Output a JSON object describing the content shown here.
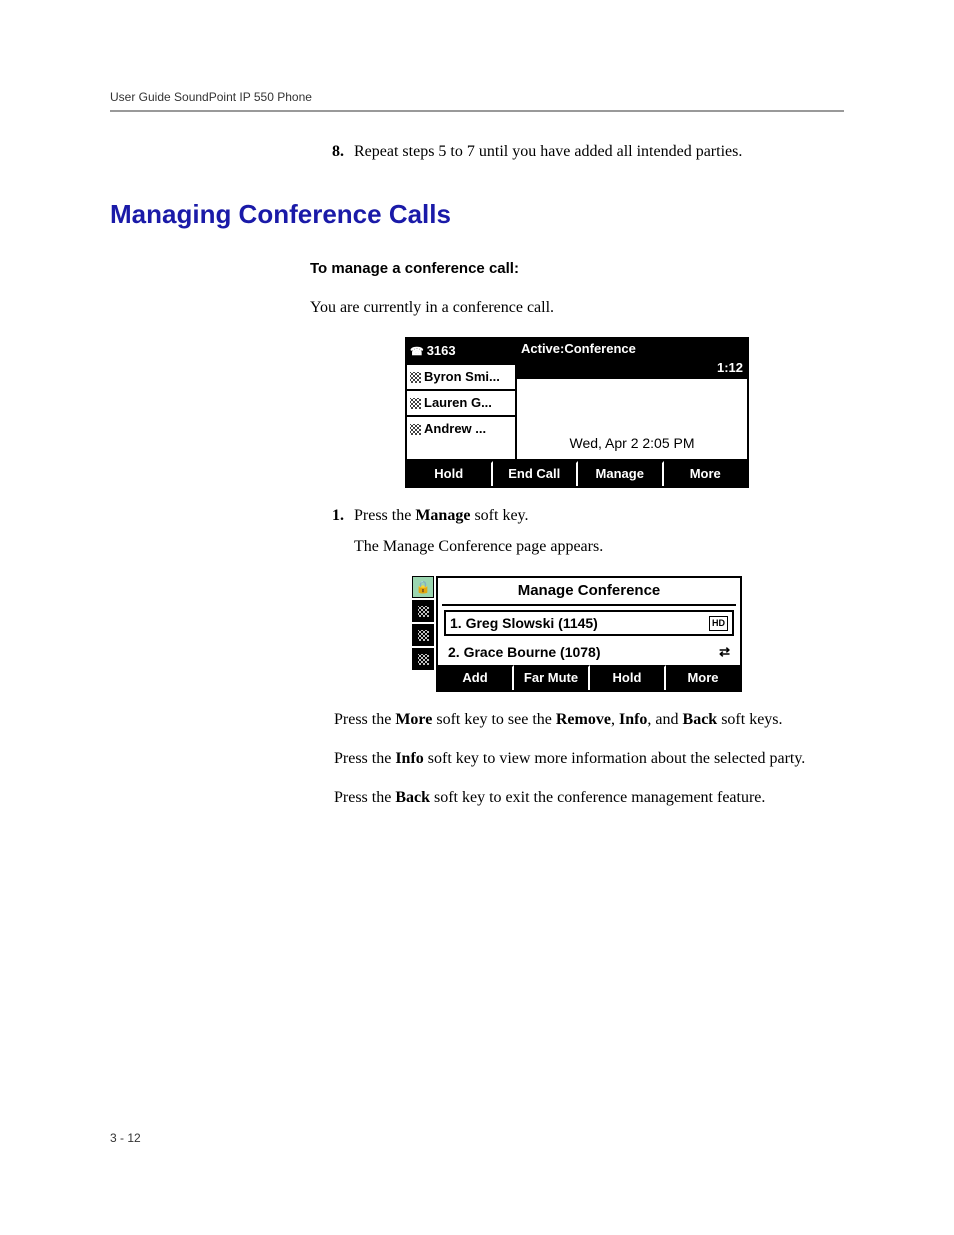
{
  "header": "User Guide SoundPoint IP 550 Phone",
  "step8": {
    "num": "8.",
    "text": "Repeat steps 5 to 7 until you have added all intended parties."
  },
  "section_title": "Managing Conference Calls",
  "sub_heading": "To manage a conference call:",
  "intro": "You are currently in a conference call.",
  "screen1": {
    "line_ext": "3163",
    "line_names": [
      "Byron Smi...",
      "Lauren G...",
      "Andrew ..."
    ],
    "banner_title": "Active:Conference",
    "banner_time": "1:12",
    "datetime": "Wed, Apr 2  2:05 PM",
    "softkeys": [
      "Hold",
      "End Call",
      "Manage",
      "More"
    ]
  },
  "step1": {
    "num": "1.",
    "text_a": "Press the ",
    "text_b": "Manage",
    "text_c": " soft key.",
    "sub": "The Manage Conference page appears."
  },
  "screen2": {
    "title": "Manage Conference",
    "entries": [
      {
        "label": "1. Greg Slowski  (1145)",
        "icon": "hd"
      },
      {
        "label": "2. Grace  Bourne (1078)",
        "icon": "swap"
      }
    ],
    "softkeys": [
      "Add",
      "Far Mute",
      "Hold",
      "More"
    ]
  },
  "para_more": {
    "a": "Press the ",
    "b": "More",
    "c": " soft key to see the ",
    "d": "Remove",
    "e": ", ",
    "f": "Info",
    "g": ", and ",
    "h": "Back",
    "i": " soft keys."
  },
  "para_info": {
    "a": "Press the ",
    "b": "Info",
    "c": " soft key to view more information about the selected party."
  },
  "para_back": {
    "a": "Press the ",
    "b": "Back",
    "c": " soft key to exit the conference management feature."
  },
  "footer": "3 - 12"
}
